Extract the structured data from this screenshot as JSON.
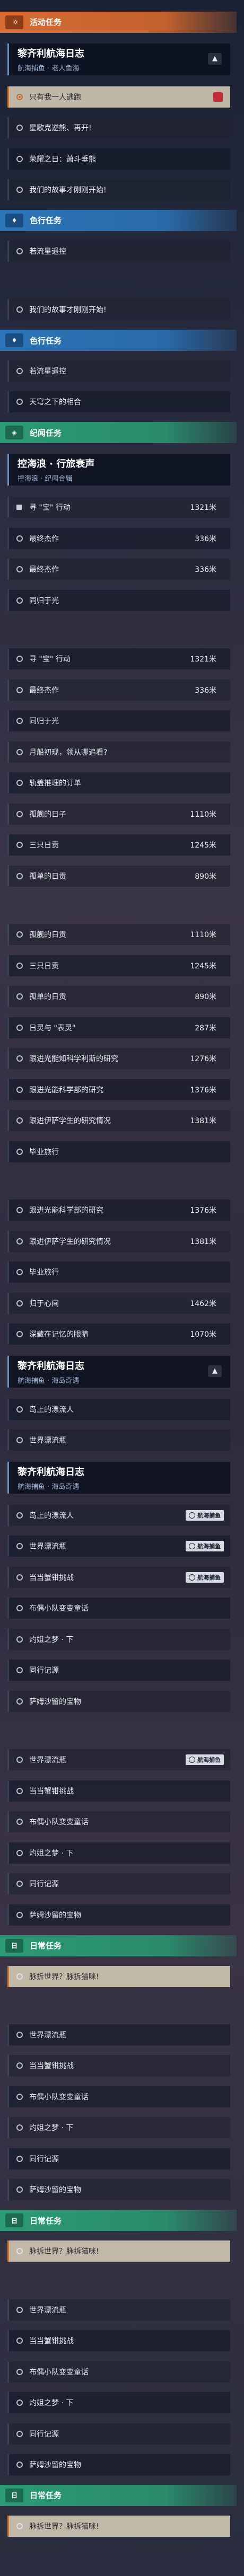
{
  "colors": {
    "accent_orange": "#d76b33",
    "accent_blue": "#2c75b8",
    "accent_green": "#2b9a76",
    "selected_row": "#cec4b0"
  },
  "sections": [
    {
      "kind": "category",
      "style": "orange",
      "tag": " ✡",
      "label": "活动任务"
    },
    {
      "kind": "header",
      "title": "黎齐利航海日志",
      "subtitle": "航海捕鱼 · 老人鱼海",
      "chev": "▲"
    },
    {
      "kind": "row",
      "icon": "circle-on",
      "label": "只有我一人逃跑",
      "sel": true,
      "marker": true
    },
    {
      "kind": "row",
      "icon": "circle",
      "label": "星歌克逆熊、再开!"
    },
    {
      "kind": "row",
      "icon": "circle",
      "label": "荣耀之日：萧斗垂熊"
    },
    {
      "kind": "row",
      "icon": "circle",
      "label": "我们的故事才刚刚开始!"
    },
    {
      "kind": "category",
      "style": "blue",
      "tag": "♦",
      "label": "色行任务"
    },
    {
      "kind": "row",
      "icon": "circle",
      "label": "若流星遥控"
    },
    {
      "kind": "gap"
    },
    {
      "kind": "row",
      "icon": "circle",
      "label": "我们的故事才刚刚开始!"
    },
    {
      "kind": "category",
      "style": "blue",
      "tag": "♦",
      "label": "色行任务"
    },
    {
      "kind": "row",
      "icon": "circle",
      "label": "若流星遥控"
    },
    {
      "kind": "row",
      "icon": "circle",
      "label": "天穹之下的相合"
    },
    {
      "kind": "category",
      "style": "green",
      "tag": "◈",
      "label": "纪闻任务"
    },
    {
      "kind": "header",
      "title": "控海浪 · 行旅衰声",
      "subtitle": "控海浪 · 纪闻合辑"
    },
    {
      "kind": "row",
      "icon": "square",
      "label": "寻 \"宝\" 行动",
      "dist": "1321米"
    },
    {
      "kind": "row",
      "icon": "circle",
      "label": "最终杰作",
      "dist": "336米"
    },
    {
      "kind": "row",
      "icon": "circle",
      "label": "最终杰作",
      "dist": "336米"
    },
    {
      "kind": "row",
      "icon": "circle",
      "label": "同归于光"
    },
    {
      "kind": "gap"
    },
    {
      "kind": "row",
      "icon": "circle",
      "label": "寻 \"宝\" 行动",
      "dist": "1321米"
    },
    {
      "kind": "row",
      "icon": "circle",
      "label": "最终杰作",
      "dist": "336米"
    },
    {
      "kind": "row",
      "icon": "circle",
      "label": "同归于光"
    },
    {
      "kind": "row",
      "icon": "circle",
      "label": "月船初现，领从哪追看?"
    },
    {
      "kind": "row",
      "icon": "circle",
      "label": "轨盖推理的订单"
    },
    {
      "kind": "row",
      "icon": "circle",
      "label": "孤舰的日子",
      "dist": "1110米"
    },
    {
      "kind": "row",
      "icon": "circle",
      "label": "三只日贡",
      "dist": "1245米"
    },
    {
      "kind": "row",
      "icon": "circle",
      "label": "孤单的日贡",
      "dist": "890米"
    },
    {
      "kind": "gap"
    },
    {
      "kind": "row",
      "icon": "circle",
      "label": "孤舰的日贡",
      "dist": "1110米"
    },
    {
      "kind": "row",
      "icon": "circle",
      "label": "三只日贡",
      "dist": "1245米"
    },
    {
      "kind": "row",
      "icon": "circle",
      "label": "孤单的日贡",
      "dist": "890米"
    },
    {
      "kind": "row",
      "icon": "circle",
      "label": "日灵与 \"表灵\"",
      "dist": "287米"
    },
    {
      "kind": "row",
      "icon": "circle",
      "label": "跟进光能知科学利斯的研究",
      "dist": "1276米"
    },
    {
      "kind": "row",
      "icon": "circle",
      "label": "跟进光能科学部的研究",
      "dist": "1376米"
    },
    {
      "kind": "row",
      "icon": "circle",
      "label": "跟进伊萨学生的研究情况",
      "dist": "1381米"
    },
    {
      "kind": "row",
      "icon": "circle",
      "label": "毕业旅行"
    },
    {
      "kind": "gap"
    },
    {
      "kind": "row",
      "icon": "circle",
      "label": "跟进光能科学部的研究",
      "dist": "1376米"
    },
    {
      "kind": "row",
      "icon": "circle",
      "label": "跟进伊萨学生的研究情况",
      "dist": "1381米"
    },
    {
      "kind": "row",
      "icon": "circle",
      "label": "毕业旅行"
    },
    {
      "kind": "row",
      "icon": "circle",
      "label": "归于心间",
      "dist": "1462米"
    },
    {
      "kind": "row",
      "icon": "circle",
      "label": "深藏在记忆的眼睛",
      "dist": "1070米"
    },
    {
      "kind": "header",
      "title": "黎齐利航海日志",
      "subtitle": "航海捕鱼 · 海岛奇遇",
      "chev": "▲"
    },
    {
      "kind": "row",
      "icon": "circle",
      "label": "岛上的漂流人"
    },
    {
      "kind": "row",
      "icon": "circle",
      "label": "世界漂流瓶"
    },
    {
      "kind": "header",
      "title": "黎齐利航海日志",
      "subtitle": "航海捕鱼 · 海岛奇遇"
    },
    {
      "kind": "row",
      "icon": "circle",
      "label": "岛上的漂流人",
      "badge": "航海捕鱼"
    },
    {
      "kind": "row",
      "icon": "circle",
      "label": "世界漂流瓶",
      "badge": "航海捕鱼"
    },
    {
      "kind": "row",
      "icon": "circle",
      "label": "当当蟹钳挑战",
      "badge": "航海捕鱼"
    },
    {
      "kind": "row",
      "icon": "circle",
      "label": "布偶小队变变童话"
    },
    {
      "kind": "row",
      "icon": "circle",
      "label": "灼姐之梦 · 下"
    },
    {
      "kind": "row",
      "icon": "circle",
      "label": "同行记源"
    },
    {
      "kind": "row",
      "icon": "circle",
      "label": "萨姆沙留的宝物"
    },
    {
      "kind": "gap"
    },
    {
      "kind": "row",
      "icon": "circle",
      "label": "世界漂流瓶",
      "badge": "航海捕鱼"
    },
    {
      "kind": "row",
      "icon": "circle",
      "label": "当当蟹钳挑战"
    },
    {
      "kind": "row",
      "icon": "circle",
      "label": "布偶小队变变童话"
    },
    {
      "kind": "row",
      "icon": "circle",
      "label": "灼姐之梦 · 下"
    },
    {
      "kind": "row",
      "icon": "circle",
      "label": "同行记源"
    },
    {
      "kind": "row",
      "icon": "circle",
      "label": "萨姆沙留的宝物"
    },
    {
      "kind": "category",
      "style": "green",
      "tag": "日",
      "label": "日常任务"
    },
    {
      "kind": "row",
      "icon": "circle",
      "label": "脉拆世界？脉拆猫咪!",
      "sel": true
    },
    {
      "kind": "gap"
    },
    {
      "kind": "row",
      "icon": "circle",
      "label": "世界漂流瓶"
    },
    {
      "kind": "row",
      "icon": "circle",
      "label": "当当蟹钳挑战"
    },
    {
      "kind": "row",
      "icon": "circle",
      "label": "布偶小队变变童话"
    },
    {
      "kind": "row",
      "icon": "circle",
      "label": "灼姐之梦 · 下"
    },
    {
      "kind": "row",
      "icon": "circle",
      "label": "同行记源"
    },
    {
      "kind": "row",
      "icon": "circle",
      "label": "萨姆沙留的宝物"
    },
    {
      "kind": "category",
      "style": "green",
      "tag": "日",
      "label": "日常任务"
    },
    {
      "kind": "row",
      "icon": "circle",
      "label": "脉拆世界？脉拆猫咪!",
      "sel": true
    },
    {
      "kind": "gap"
    },
    {
      "kind": "row",
      "icon": "circle",
      "label": "世界漂流瓶"
    },
    {
      "kind": "row",
      "icon": "circle",
      "label": "当当蟹钳挑战"
    },
    {
      "kind": "row",
      "icon": "circle",
      "label": "布偶小队变变童话"
    },
    {
      "kind": "row",
      "icon": "circle",
      "label": "灼姐之梦 · 下"
    },
    {
      "kind": "row",
      "icon": "circle",
      "label": "同行记源"
    },
    {
      "kind": "row",
      "icon": "circle",
      "label": "萨姆沙留的宝物"
    },
    {
      "kind": "category",
      "style": "green",
      "tag": "日",
      "label": "日常任务"
    },
    {
      "kind": "row",
      "icon": "circle",
      "label": "脉拆世界？脉拆猫咪!",
      "sel": true
    },
    {
      "kind": "gap"
    }
  ]
}
